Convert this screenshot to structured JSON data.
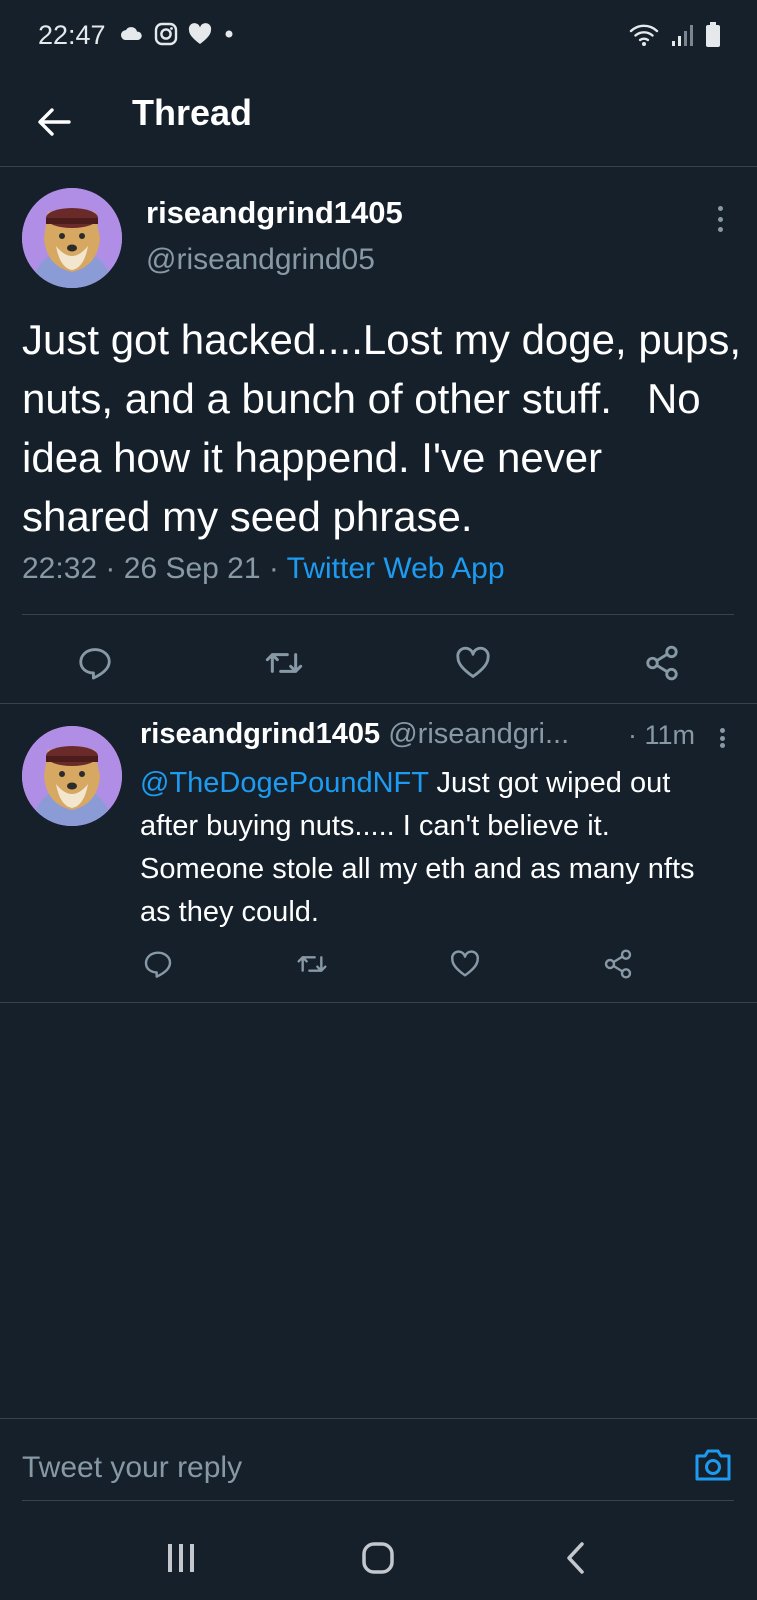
{
  "status_bar": {
    "time": "22:47",
    "left_icons": [
      "cloud-icon",
      "instagram-icon",
      "heart-icon",
      "dot-icon"
    ],
    "right_icons": [
      "wifi-icon",
      "signal-icon",
      "battery-icon"
    ]
  },
  "header": {
    "title": "Thread",
    "back_icon": "back-arrow-icon"
  },
  "main_tweet": {
    "display_name": "riseandgrind1405",
    "handle": "@riseandgrind05",
    "text": "Just got hacked....Lost my doge, pups, nuts, and a bunch of other stuff.   No idea how it happend. I've never shared my seed phrase.",
    "time": "22:32",
    "separator": " · ",
    "date": "26 Sep 21",
    "source": "Twitter Web App",
    "actions": [
      "reply-icon",
      "retweet-icon",
      "like-icon",
      "share-icon"
    ]
  },
  "reply_tweet": {
    "display_name": "riseandgrind1405",
    "handle": "@riseandgri...",
    "time": "· 11m",
    "mention": "@TheDogePoundNFT",
    "text": " Just got wiped out after buying nuts..... I can't believe it. Someone stole all my eth and as many nfts as they could.",
    "actions": [
      "reply-icon",
      "retweet-icon",
      "like-icon",
      "share-icon"
    ]
  },
  "reply_box": {
    "placeholder": "Tweet your reply",
    "camera_icon": "camera-icon"
  },
  "nav_bar": {
    "buttons": [
      "recent-apps-icon",
      "home-icon",
      "back-icon"
    ]
  },
  "colors": {
    "background": "#15202b",
    "accent": "#1d9bf0",
    "secondary_text": "#8899a6",
    "divider": "#38444d",
    "avatar_bg": "#b08ee6"
  }
}
